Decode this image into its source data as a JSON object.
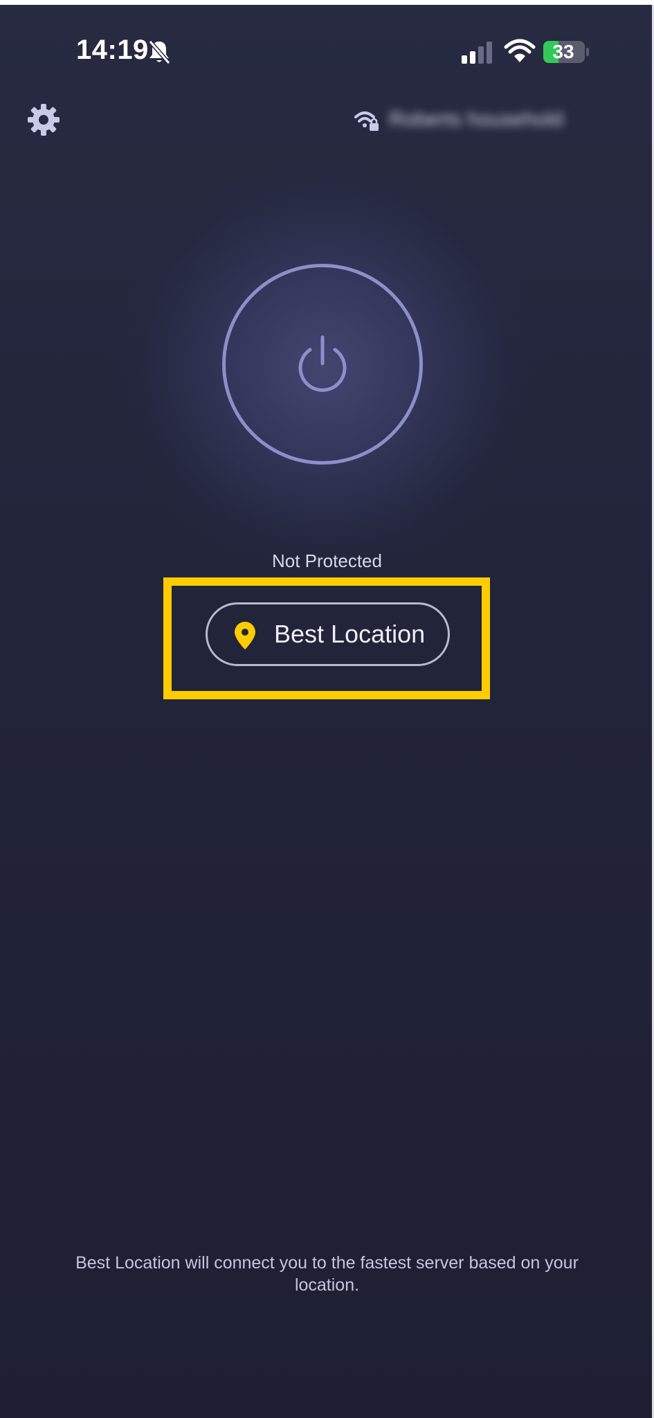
{
  "status_bar": {
    "time": "14:19",
    "bell_icon": "bell-slash-icon",
    "signal_icon": "cellular-signal-icon",
    "wifi_icon": "wifi-icon",
    "battery_level": "33",
    "battery_color": "#34c759"
  },
  "toolbar": {
    "settings_icon": "gear-icon",
    "network_icon": "secure-wifi-icon",
    "network_name": "Roberts household"
  },
  "power": {
    "icon": "power-icon",
    "ring_color": "#8c8fc9"
  },
  "connection": {
    "status": "Not Protected"
  },
  "location": {
    "label": "Best Location",
    "icon": "location-pin-icon",
    "accent_color": "#ffcc00"
  },
  "footer": {
    "info": "Best Location will connect you to the fastest server based on your location."
  }
}
